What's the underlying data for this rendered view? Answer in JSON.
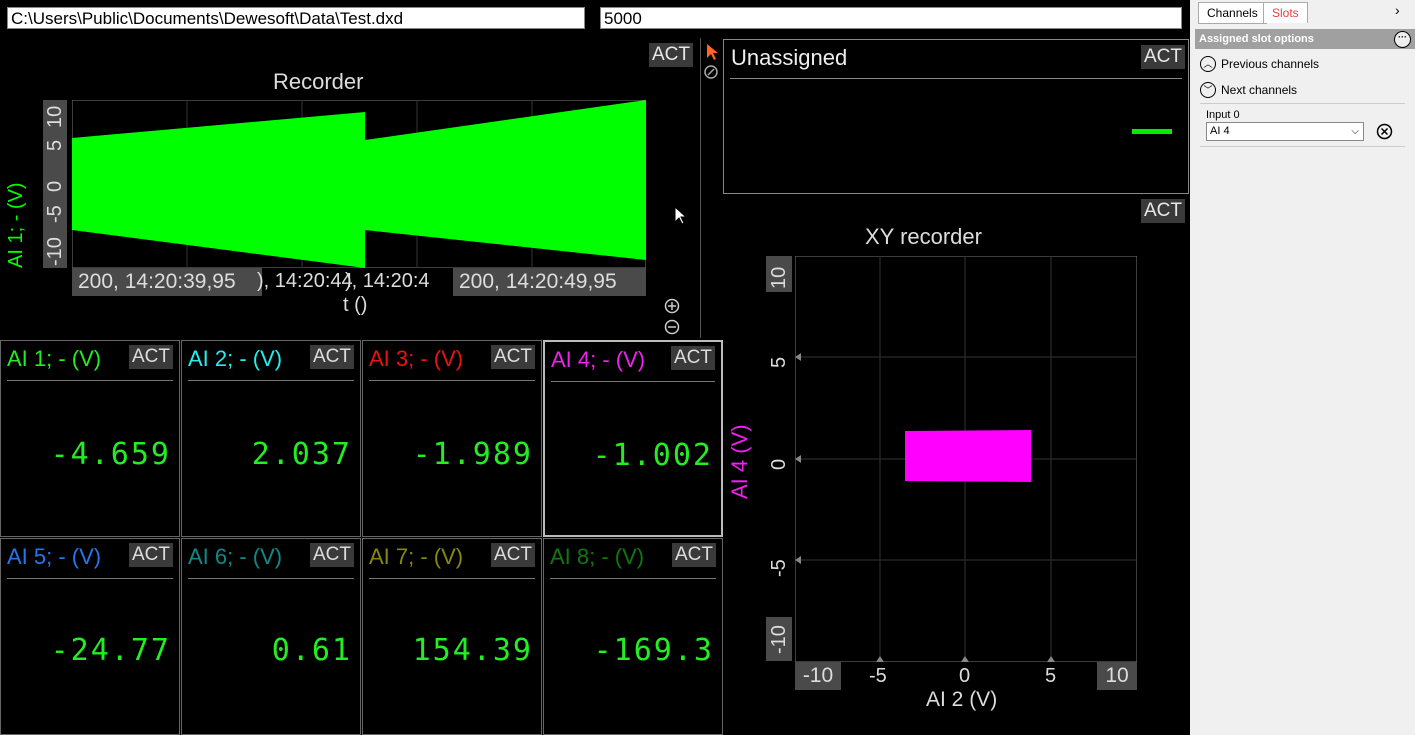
{
  "header": {
    "file_path": "C:\\Users\\Public\\Documents\\Dewesoft\\Data\\Test.dxd",
    "sample_value": "5000"
  },
  "recorder": {
    "act": "ACT",
    "title": "Recorder",
    "ylabel": "AI 1; - (V)",
    "xlabel": "t ()",
    "yticks": [
      "10",
      "5",
      "0",
      "-5",
      "-10"
    ],
    "xticks": [
      "200, 14:20:39,95",
      "), 14:20:44",
      "200, 14:20:49,95"
    ],
    "x_overlap_label": "), 14:20:4",
    "color": "#00ff00"
  },
  "unassigned": {
    "title": "Unassigned",
    "act": "ACT"
  },
  "xy_recorder": {
    "act": "ACT",
    "title": "XY recorder",
    "xlabel": "AI 2 (V)",
    "ylabel": "AI 4 (V)",
    "xticks": [
      "-10",
      "-5",
      "0",
      "5",
      "10"
    ],
    "yticks": [
      "10",
      "5",
      "0",
      "-5",
      "-10"
    ],
    "color": "#ff00ff"
  },
  "digital_meters": [
    {
      "label": "AI 1; - (V)",
      "value": "-4.659",
      "color": "#22ee22",
      "act": "ACT"
    },
    {
      "label": "AI 2; - (V)",
      "value": "2.037",
      "color": "#22eeee",
      "act": "ACT"
    },
    {
      "label": "AI 3; - (V)",
      "value": "-1.989",
      "color": "#ee1111",
      "act": "ACT"
    },
    {
      "label": "AI 4; - (V)",
      "value": "-1.002",
      "color": "#ee22ee",
      "act": "ACT"
    },
    {
      "label": "AI 5; - (V)",
      "value": "-24.77",
      "color": "#2277ee",
      "act": "ACT"
    },
    {
      "label": "AI 6; - (V)",
      "value": "0.61",
      "color": "#118888",
      "act": "ACT"
    },
    {
      "label": "AI 7; - (V)",
      "value": "154.39",
      "color": "#888811",
      "act": "ACT"
    },
    {
      "label": "AI 8; - (V)",
      "value": "-169.3",
      "color": "#117711",
      "act": "ACT"
    }
  ],
  "side_panel": {
    "tabs": [
      "Channels",
      "Slots"
    ],
    "active_tab": "Slots",
    "section_title": "Assigned slot options",
    "previous_channels": "Previous channels",
    "next_channels": "Next channels",
    "input_label": "Input 0",
    "input_value": "AI 4"
  }
}
